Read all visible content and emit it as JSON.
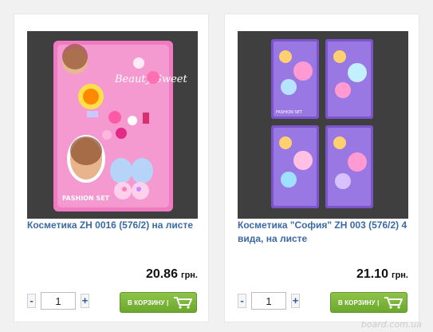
{
  "products": [
    {
      "title": "Косметика ZH 0016 (576/2) на листе",
      "price": "20.86",
      "currency": "грн.",
      "quantity": "1",
      "minus_label": "-",
      "plus_label": "+",
      "cart_label": "В КОРЗИНУ |",
      "cart_icon": "shopping-cart-icon",
      "image_text": "FASHION SET",
      "image_brand": "Beauty Sweet"
    },
    {
      "title": "Косметика \"София\" ZH 003 (576/2) 4 вида, на листе",
      "price": "21.10",
      "currency": "грн.",
      "quantity": "1",
      "minus_label": "-",
      "plus_label": "+",
      "cart_label": "В КОРЗИНУ |",
      "cart_icon": "shopping-cart-icon",
      "image_text": "FASHION SET"
    }
  ],
  "watermark": "board.com.ua",
  "colors": {
    "title_link": "#3a6aa6",
    "cart_button": "#7ab53a",
    "photo_background": "#3f3f3f"
  }
}
